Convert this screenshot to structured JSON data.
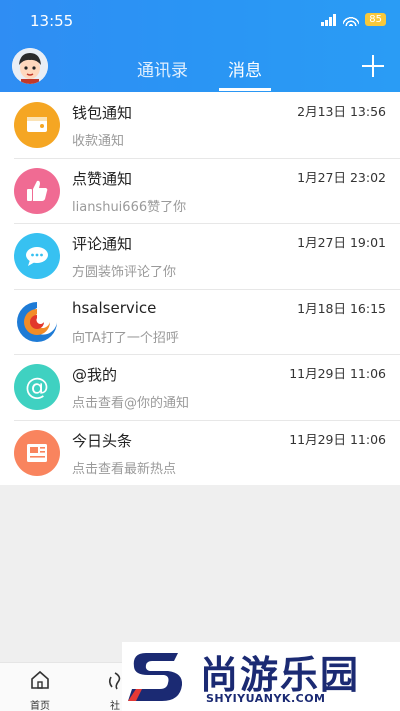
{
  "status_bar": {
    "time": "13:55",
    "battery": "85",
    "network": "4G"
  },
  "header": {
    "tabs": [
      {
        "label": "通讯录",
        "active": false
      },
      {
        "label": "消息",
        "active": true
      }
    ]
  },
  "messages": [
    {
      "title": "钱包通知",
      "subtitle": "收款通知",
      "time": "2月13日 13:56",
      "icon": "wallet-icon",
      "color": "#f5a623"
    },
    {
      "title": "点赞通知",
      "subtitle": "lianshui666赞了你",
      "time": "1月27日 23:02",
      "icon": "thumbs-up-icon",
      "color": "#f06b93"
    },
    {
      "title": "评论通知",
      "subtitle": "方圆装饰评论了你",
      "time": "1月27日 19:01",
      "icon": "comment-icon",
      "color": "#37c1f1"
    },
    {
      "title": "hsalservice",
      "subtitle": "向TA打了一个招呼",
      "time": "1月18日 16:15",
      "icon": "service-logo-icon",
      "color": "#1e7bd6"
    },
    {
      "title": "@我的",
      "subtitle": "点击查看@你的通知",
      "time": "11月29日 11:06",
      "icon": "at-icon",
      "color": "#3fd1c1"
    },
    {
      "title": "今日头条",
      "subtitle": "点击查看最新热点",
      "time": "11月29日 11:06",
      "icon": "newspaper-icon",
      "color": "#f9845e"
    }
  ],
  "bottom_nav": [
    {
      "label": "首页",
      "icon": "home-icon"
    },
    {
      "label": "社",
      "icon": "community-icon"
    }
  ],
  "watermark": {
    "text": "尚游乐园",
    "url": "SHYIYUANYK.COM"
  }
}
